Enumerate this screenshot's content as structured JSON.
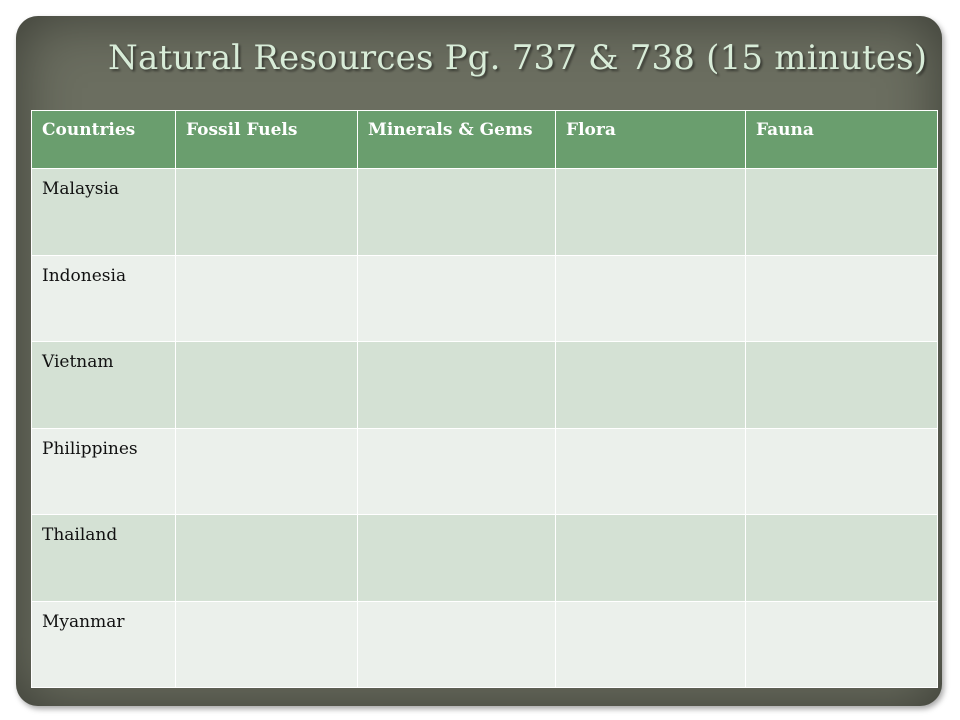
{
  "slide": {
    "title": "Natural Resources Pg. 737 & 738 (15 minutes)"
  },
  "table": {
    "headers": [
      "Countries",
      "Fossil Fuels",
      "Minerals & Gems",
      "Flora",
      "Fauna"
    ],
    "rows": [
      [
        "Malaysia",
        "",
        "",
        "",
        ""
      ],
      [
        "Indonesia",
        "",
        "",
        "",
        ""
      ],
      [
        "Vietnam",
        "",
        "",
        "",
        ""
      ],
      [
        "Philippines",
        "",
        "",
        "",
        ""
      ],
      [
        "Thailand",
        "",
        "",
        "",
        ""
      ],
      [
        "Myanmar",
        "",
        "",
        "",
        ""
      ]
    ]
  },
  "colors": {
    "frame": "#6b6e60",
    "header": "#6a9e6e",
    "row_odd": "#d4e1d4",
    "row_even": "#ebf0eb",
    "title_text": "#d8ecd8"
  }
}
